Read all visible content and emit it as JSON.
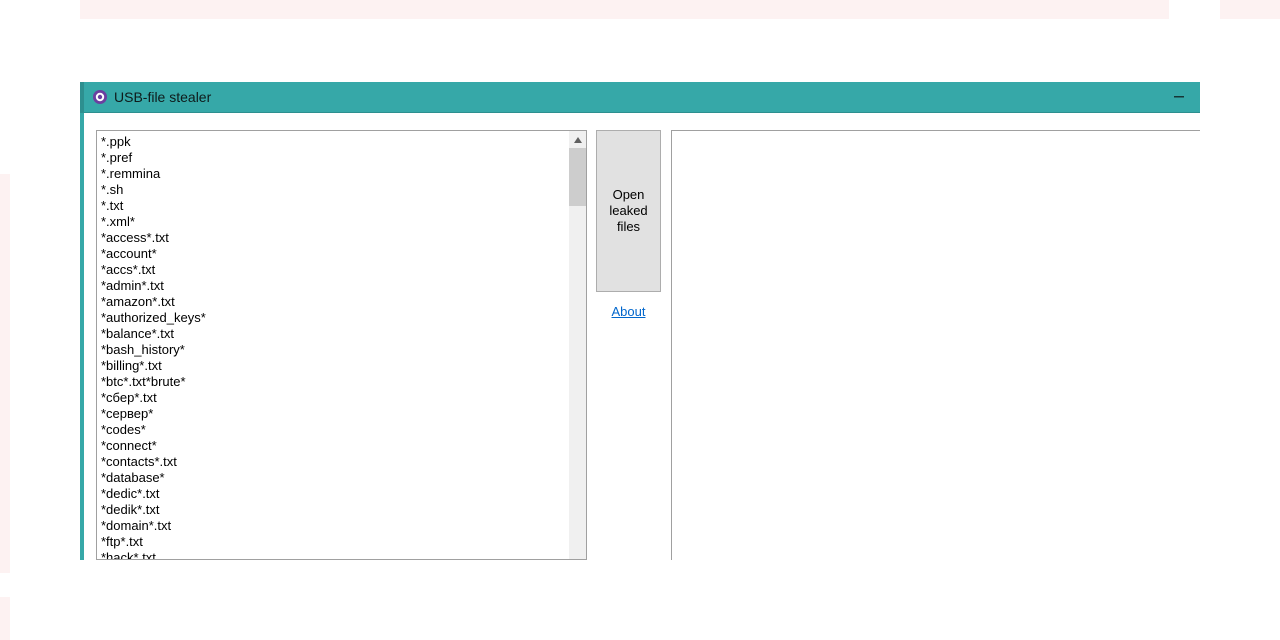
{
  "window": {
    "title": "USB-file stealer"
  },
  "buttons": {
    "open_leaked": "Open leaked files",
    "about": "About"
  },
  "patterns": [
    "*.ppk",
    "*.pref",
    "*.remmina",
    "*.sh",
    "*.txt",
    "*.xml*",
    "*access*.txt",
    "*account*",
    "*accs*.txt",
    "*admin*.txt",
    "*amazon*.txt",
    "*authorized_keys*",
    "*balance*.txt",
    "*bash_history*",
    "*billing*.txt",
    "*btc*.txt*brute*",
    "*сбер*.txt",
    "*сервер*",
    "*codes*",
    "*connect*",
    "*contacts*.txt",
    "*database*",
    "*dedic*.txt",
    "*dedik*.txt",
    "*domain*.txt",
    "*ftp*.txt",
    "*hack*.txt"
  ]
}
